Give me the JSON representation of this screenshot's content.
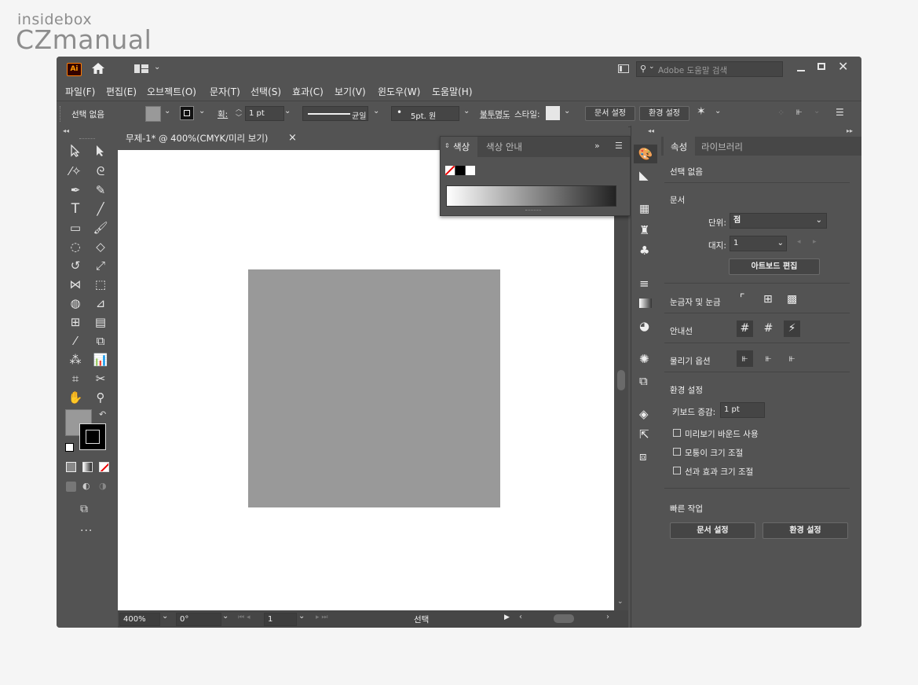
{
  "watermark": {
    "line1": "insidebox",
    "line2": "CZmanual"
  },
  "app": {
    "logo": "Ai"
  },
  "search": {
    "placeholder": "Adobe 도움말 검색"
  },
  "menu": [
    "파일(F)",
    "편집(E)",
    "오브젝트(O)",
    "문자(T)",
    "선택(S)",
    "효과(C)",
    "보기(V)",
    "윈도우(W)",
    "도움말(H)"
  ],
  "control": {
    "selection": "선택 없음",
    "stroke_label": "획:",
    "stroke_value": "1 pt",
    "profile_label": "균일",
    "brush_label": "5pt. 원",
    "opacity_label": "불투명도",
    "style_label": "스타일:",
    "doc_setup": "문서 설정",
    "preferences": "환경 설정"
  },
  "document": {
    "tab_title": "무제-1* @ 400%(CMYK/미리 보기)",
    "close": "×"
  },
  "canvas": {
    "rect_color": "#999999"
  },
  "status": {
    "zoom": "400%",
    "rotation": "0°",
    "artboard": "1",
    "tool": "선택"
  },
  "color_panel": {
    "tab1": "색상",
    "tab2": "색상 안내"
  },
  "properties": {
    "tab1": "속성",
    "tab2": "라이브러리",
    "no_selection": "선택 없음",
    "section_document": "문서",
    "unit_label": "단위:",
    "unit_value": "점",
    "artboard_label": "대지:",
    "artboard_value": "1",
    "edit_artboards": "아트보드 편집",
    "rulers_grids": "눈금자 및 눈금",
    "guides": "안내선",
    "snap_options": "물리기 옵션",
    "preferences": "환경 설정",
    "keyboard_increment_label": "키보드 증감:",
    "keyboard_increment_value": "1 pt",
    "preview_bounds": "미리보기 바운드 사용",
    "scale_corners": "모퉁이 크기 조절",
    "scale_strokes": "선과 효과 크기 조절",
    "quick_actions": "빠른 작업",
    "doc_setup_btn": "문서 설정",
    "prefs_btn": "환경 설정"
  }
}
